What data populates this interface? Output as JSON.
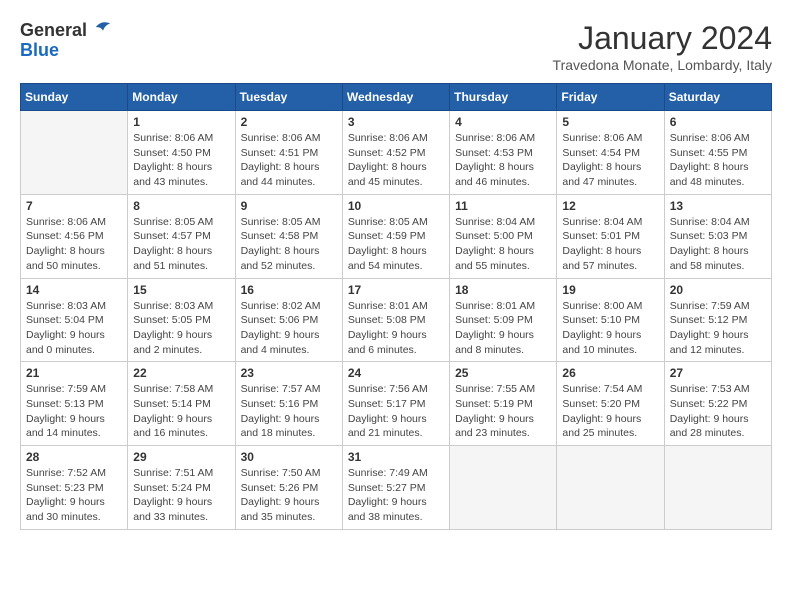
{
  "header": {
    "logo_line1": "General",
    "logo_line2": "Blue",
    "month_title": "January 2024",
    "location": "Travedona Monate, Lombardy, Italy"
  },
  "weekdays": [
    "Sunday",
    "Monday",
    "Tuesday",
    "Wednesday",
    "Thursday",
    "Friday",
    "Saturday"
  ],
  "weeks": [
    [
      {
        "day": "",
        "info": ""
      },
      {
        "day": "1",
        "info": "Sunrise: 8:06 AM\nSunset: 4:50 PM\nDaylight: 8 hours\nand 43 minutes."
      },
      {
        "day": "2",
        "info": "Sunrise: 8:06 AM\nSunset: 4:51 PM\nDaylight: 8 hours\nand 44 minutes."
      },
      {
        "day": "3",
        "info": "Sunrise: 8:06 AM\nSunset: 4:52 PM\nDaylight: 8 hours\nand 45 minutes."
      },
      {
        "day": "4",
        "info": "Sunrise: 8:06 AM\nSunset: 4:53 PM\nDaylight: 8 hours\nand 46 minutes."
      },
      {
        "day": "5",
        "info": "Sunrise: 8:06 AM\nSunset: 4:54 PM\nDaylight: 8 hours\nand 47 minutes."
      },
      {
        "day": "6",
        "info": "Sunrise: 8:06 AM\nSunset: 4:55 PM\nDaylight: 8 hours\nand 48 minutes."
      }
    ],
    [
      {
        "day": "7",
        "info": "Sunrise: 8:06 AM\nSunset: 4:56 PM\nDaylight: 8 hours\nand 50 minutes."
      },
      {
        "day": "8",
        "info": "Sunrise: 8:05 AM\nSunset: 4:57 PM\nDaylight: 8 hours\nand 51 minutes."
      },
      {
        "day": "9",
        "info": "Sunrise: 8:05 AM\nSunset: 4:58 PM\nDaylight: 8 hours\nand 52 minutes."
      },
      {
        "day": "10",
        "info": "Sunrise: 8:05 AM\nSunset: 4:59 PM\nDaylight: 8 hours\nand 54 minutes."
      },
      {
        "day": "11",
        "info": "Sunrise: 8:04 AM\nSunset: 5:00 PM\nDaylight: 8 hours\nand 55 minutes."
      },
      {
        "day": "12",
        "info": "Sunrise: 8:04 AM\nSunset: 5:01 PM\nDaylight: 8 hours\nand 57 minutes."
      },
      {
        "day": "13",
        "info": "Sunrise: 8:04 AM\nSunset: 5:03 PM\nDaylight: 8 hours\nand 58 minutes."
      }
    ],
    [
      {
        "day": "14",
        "info": "Sunrise: 8:03 AM\nSunset: 5:04 PM\nDaylight: 9 hours\nand 0 minutes."
      },
      {
        "day": "15",
        "info": "Sunrise: 8:03 AM\nSunset: 5:05 PM\nDaylight: 9 hours\nand 2 minutes."
      },
      {
        "day": "16",
        "info": "Sunrise: 8:02 AM\nSunset: 5:06 PM\nDaylight: 9 hours\nand 4 minutes."
      },
      {
        "day": "17",
        "info": "Sunrise: 8:01 AM\nSunset: 5:08 PM\nDaylight: 9 hours\nand 6 minutes."
      },
      {
        "day": "18",
        "info": "Sunrise: 8:01 AM\nSunset: 5:09 PM\nDaylight: 9 hours\nand 8 minutes."
      },
      {
        "day": "19",
        "info": "Sunrise: 8:00 AM\nSunset: 5:10 PM\nDaylight: 9 hours\nand 10 minutes."
      },
      {
        "day": "20",
        "info": "Sunrise: 7:59 AM\nSunset: 5:12 PM\nDaylight: 9 hours\nand 12 minutes."
      }
    ],
    [
      {
        "day": "21",
        "info": "Sunrise: 7:59 AM\nSunset: 5:13 PM\nDaylight: 9 hours\nand 14 minutes."
      },
      {
        "day": "22",
        "info": "Sunrise: 7:58 AM\nSunset: 5:14 PM\nDaylight: 9 hours\nand 16 minutes."
      },
      {
        "day": "23",
        "info": "Sunrise: 7:57 AM\nSunset: 5:16 PM\nDaylight: 9 hours\nand 18 minutes."
      },
      {
        "day": "24",
        "info": "Sunrise: 7:56 AM\nSunset: 5:17 PM\nDaylight: 9 hours\nand 21 minutes."
      },
      {
        "day": "25",
        "info": "Sunrise: 7:55 AM\nSunset: 5:19 PM\nDaylight: 9 hours\nand 23 minutes."
      },
      {
        "day": "26",
        "info": "Sunrise: 7:54 AM\nSunset: 5:20 PM\nDaylight: 9 hours\nand 25 minutes."
      },
      {
        "day": "27",
        "info": "Sunrise: 7:53 AM\nSunset: 5:22 PM\nDaylight: 9 hours\nand 28 minutes."
      }
    ],
    [
      {
        "day": "28",
        "info": "Sunrise: 7:52 AM\nSunset: 5:23 PM\nDaylight: 9 hours\nand 30 minutes."
      },
      {
        "day": "29",
        "info": "Sunrise: 7:51 AM\nSunset: 5:24 PM\nDaylight: 9 hours\nand 33 minutes."
      },
      {
        "day": "30",
        "info": "Sunrise: 7:50 AM\nSunset: 5:26 PM\nDaylight: 9 hours\nand 35 minutes."
      },
      {
        "day": "31",
        "info": "Sunrise: 7:49 AM\nSunset: 5:27 PM\nDaylight: 9 hours\nand 38 minutes."
      },
      {
        "day": "",
        "info": ""
      },
      {
        "day": "",
        "info": ""
      },
      {
        "day": "",
        "info": ""
      }
    ]
  ]
}
